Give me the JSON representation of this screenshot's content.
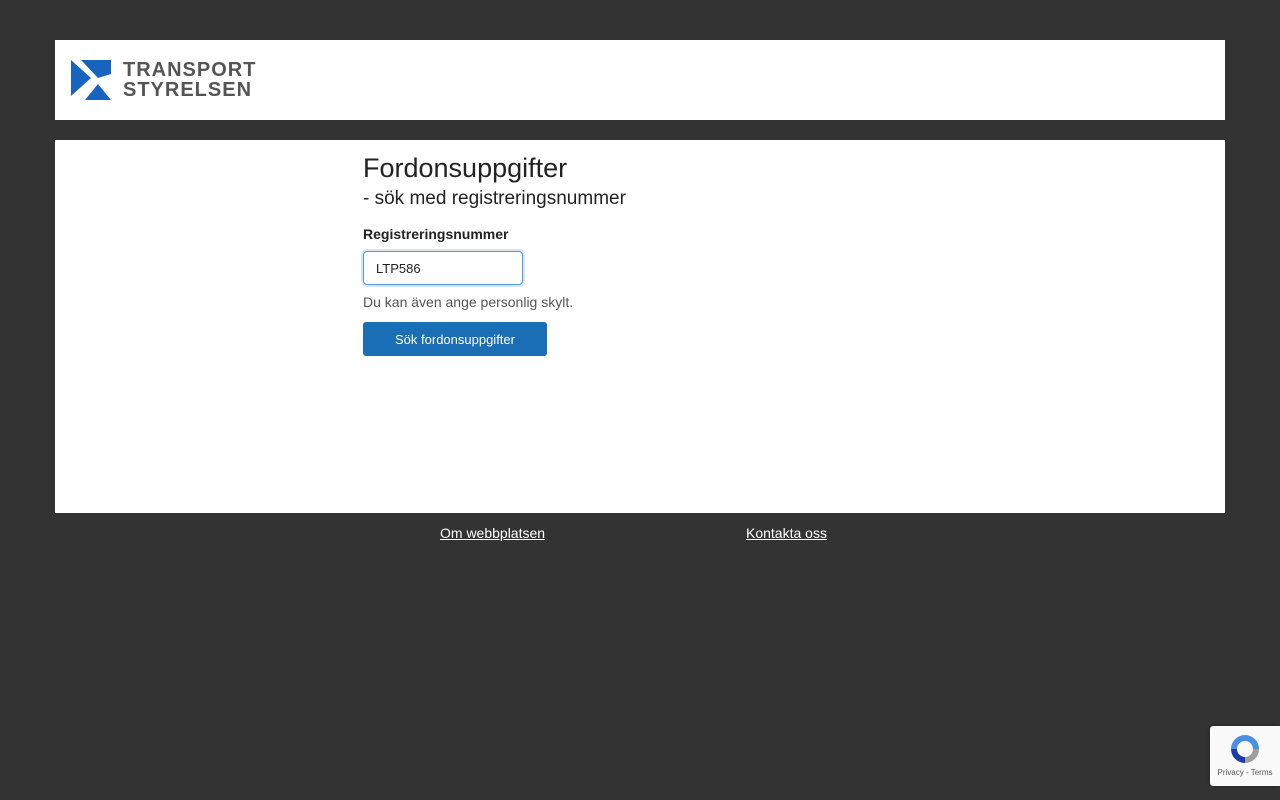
{
  "header": {
    "logo_line1": "TRANSPORT",
    "logo_line2": "STYRELSEN"
  },
  "form": {
    "title": "Fordonsuppgifter",
    "subtitle": "- sök med registreringsnummer",
    "field_label": "Registreringsnummer",
    "field_value": "LTP586",
    "hint": "Du kan även ange personlig skylt.",
    "submit_label": "Sök fordonsuppgifter"
  },
  "footer": {
    "link_about": "Om webbplatsen",
    "link_contact": "Kontakta oss"
  },
  "recaptcha": {
    "terms_text": "Privacy - Terms"
  },
  "colors": {
    "page_background": "#333333",
    "panel_background": "#ffffff",
    "logo_blue": "#1763c0",
    "button_blue": "#1a6eb5",
    "input_focus_border": "#5b9bd5"
  }
}
